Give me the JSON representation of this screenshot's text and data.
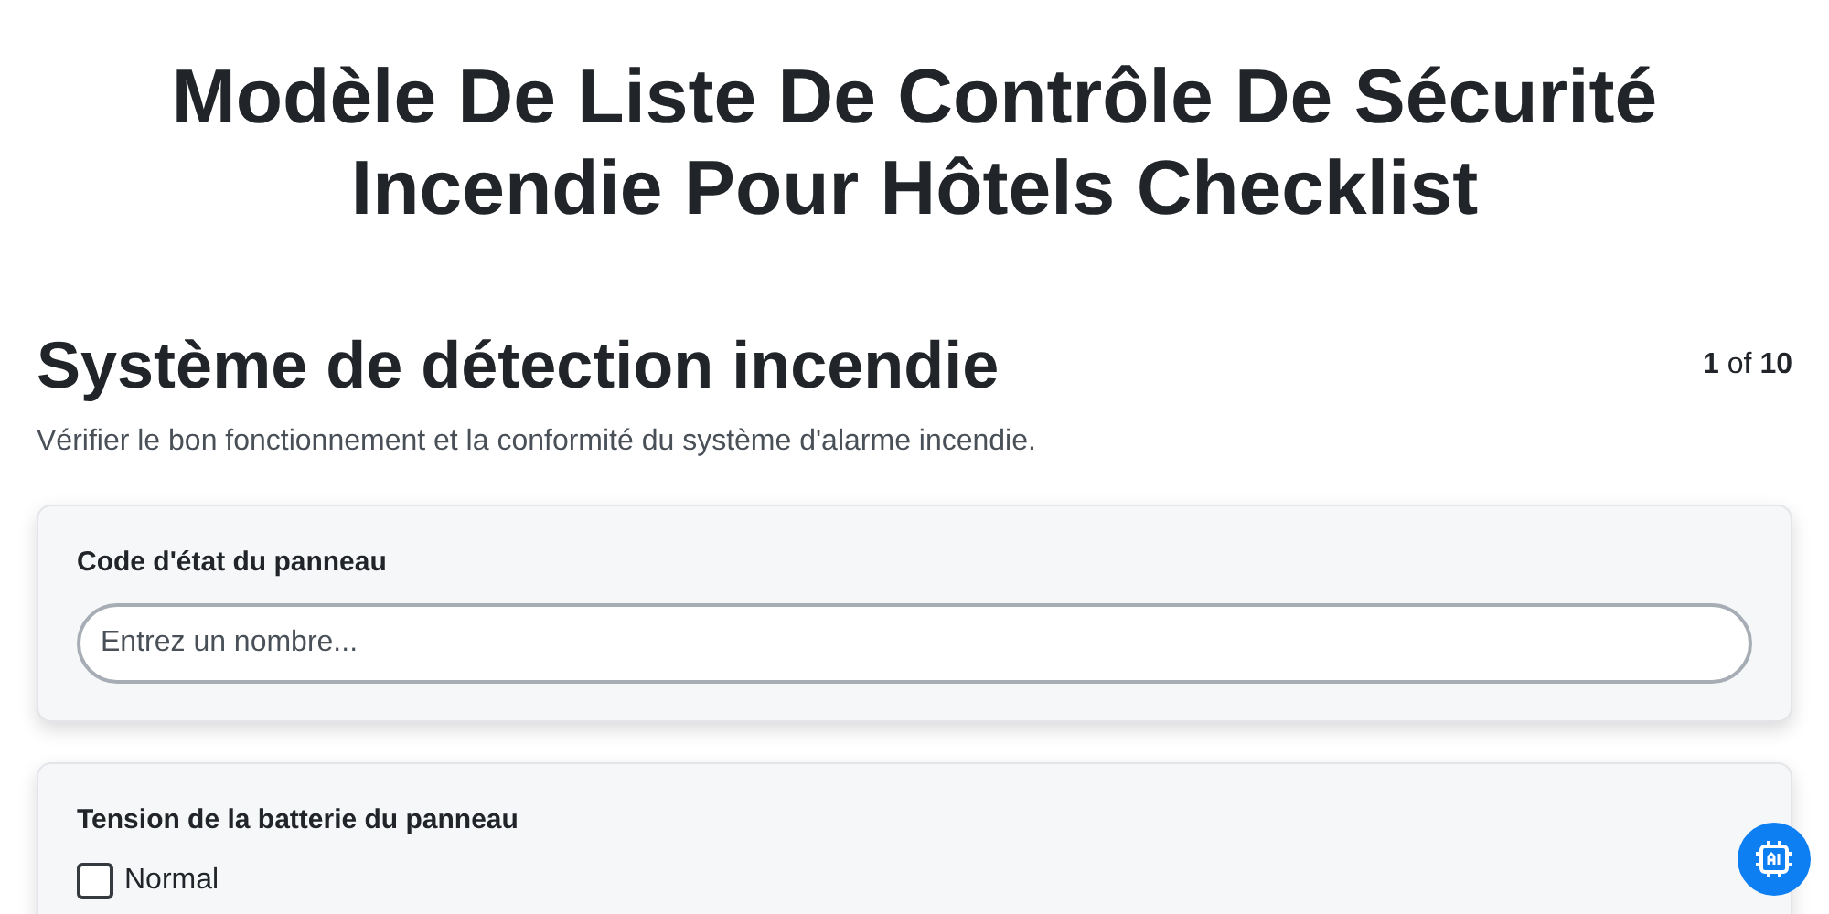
{
  "title": "Modèle De Liste De Contrôle De Sécurité Incendie Pour Hôtels Checklist",
  "section": {
    "heading": "Système de détection incendie",
    "pager": {
      "current": "1",
      "of": "of",
      "total": "10"
    },
    "description": "Vérifier le bon fonctionnement et la conformité du système d'alarme incendie."
  },
  "questions": [
    {
      "kind": "number",
      "label": "Code d'état du panneau",
      "placeholder": "Entrez un nombre..."
    },
    {
      "kind": "checkboxes",
      "label": "Tension de la batterie du panneau",
      "options": [
        {
          "label": "Normal",
          "checked": false
        }
      ]
    }
  ]
}
